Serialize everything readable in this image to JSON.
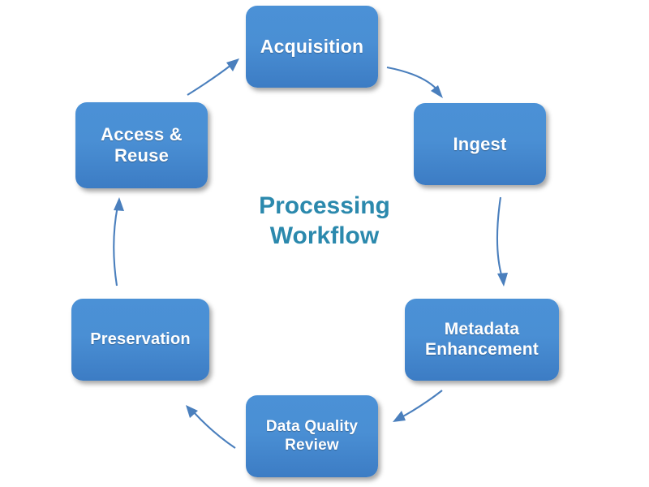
{
  "diagram": {
    "title": "Processing Workflow",
    "center_caption_lines": "Processing\nWorkflow",
    "accent_color": "#2b89ad",
    "node_fill_color": "#4a8fd4",
    "arrow_color": "#4a7fbd",
    "background_color": "#ffffff",
    "nodes": [
      {
        "id": "acquisition",
        "label": "Acquisition"
      },
      {
        "id": "ingest",
        "label": "Ingest"
      },
      {
        "id": "metadata",
        "label": "Metadata\nEnhancement"
      },
      {
        "id": "dataquality",
        "label": "Data Quality\nReview"
      },
      {
        "id": "preservation",
        "label": "Preservation"
      },
      {
        "id": "access",
        "label": "Access &\nReuse"
      }
    ],
    "arrows": [
      {
        "id": "acquisition-to-ingest",
        "from": "Acquisition",
        "to": "Ingest"
      },
      {
        "id": "ingest-to-metadata",
        "from": "Ingest",
        "to": "Metadata Enhancement"
      },
      {
        "id": "metadata-to-dataquality",
        "from": "Metadata Enhancement",
        "to": "Data Quality Review"
      },
      {
        "id": "dataquality-to-preservation",
        "from": "Data Quality Review",
        "to": "Preservation"
      },
      {
        "id": "preservation-to-access",
        "from": "Preservation",
        "to": "Access & Reuse"
      },
      {
        "id": "access-to-acquisition",
        "from": "Access & Reuse",
        "to": "Acquisition"
      }
    ]
  }
}
